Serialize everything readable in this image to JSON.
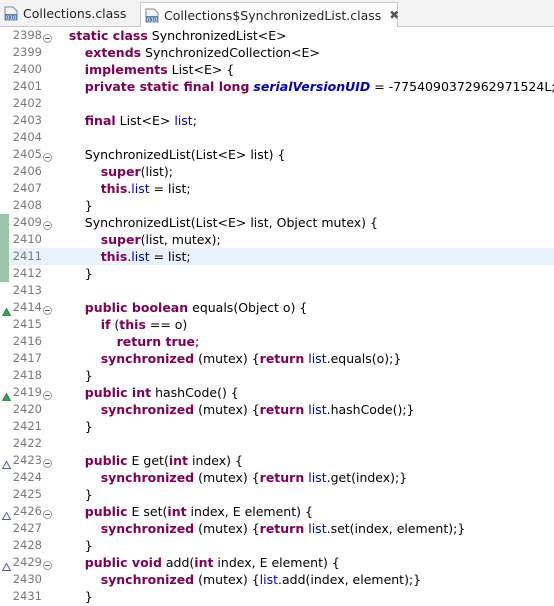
{
  "tabs": [
    {
      "label": "Collections.class",
      "icon": "class-file-icon",
      "active": false
    },
    {
      "label": "Collections$SynchronizedList.class",
      "icon": "class-file-icon",
      "active": true,
      "close": "✖"
    }
  ],
  "lines": [
    {
      "n": "2398",
      "fold": "minus",
      "segs": [
        [
          "",
          "    "
        ],
        [
          "kw",
          "static class"
        ],
        [
          "",
          " SynchronizedList<E>"
        ]
      ]
    },
    {
      "n": "2399",
      "segs": [
        [
          "",
          "        "
        ],
        [
          "kw",
          "extends"
        ],
        [
          "",
          " SynchronizedCollection<E>"
        ]
      ]
    },
    {
      "n": "2400",
      "segs": [
        [
          "",
          "        "
        ],
        [
          "kw",
          "implements"
        ],
        [
          "",
          " List<E> {"
        ]
      ]
    },
    {
      "n": "2401",
      "segs": [
        [
          "",
          "        "
        ],
        [
          "kw",
          "private static final long"
        ],
        [
          "",
          " "
        ],
        [
          "sfld",
          "serialVersionUID"
        ],
        [
          "",
          " = -7754090372962971524L;"
        ]
      ]
    },
    {
      "n": "2402",
      "segs": []
    },
    {
      "n": "2403",
      "segs": [
        [
          "",
          "        "
        ],
        [
          "kw",
          "final"
        ],
        [
          "",
          " List<E> "
        ],
        [
          "fld",
          "list"
        ],
        [
          "",
          ";"
        ]
      ]
    },
    {
      "n": "2404",
      "segs": []
    },
    {
      "n": "2405",
      "fold": "minus",
      "segs": [
        [
          "",
          "        SynchronizedList(List<E> list) {"
        ]
      ]
    },
    {
      "n": "2406",
      "segs": [
        [
          "",
          "            "
        ],
        [
          "kw",
          "super"
        ],
        [
          "",
          "(list);"
        ]
      ]
    },
    {
      "n": "2407",
      "segs": [
        [
          "",
          "            "
        ],
        [
          "kw",
          "this"
        ],
        [
          "",
          "."
        ],
        [
          "fld",
          "list"
        ],
        [
          "",
          " = list;"
        ]
      ]
    },
    {
      "n": "2408",
      "segs": [
        [
          "",
          "        }"
        ]
      ]
    },
    {
      "n": "2409",
      "fold": "minus",
      "marker": true,
      "segs": [
        [
          "",
          "        SynchronizedList(List<E> list, Object mutex) {"
        ]
      ]
    },
    {
      "n": "2410",
      "marker": true,
      "segs": [
        [
          "",
          "            "
        ],
        [
          "kw",
          "super"
        ],
        [
          "",
          "(list, mutex);"
        ]
      ]
    },
    {
      "n": "2411",
      "marker": true,
      "hl": true,
      "segs": [
        [
          "",
          "            "
        ],
        [
          "kw",
          "this"
        ],
        [
          "",
          "."
        ],
        [
          "fld",
          "list"
        ],
        [
          "",
          " = list;"
        ]
      ]
    },
    {
      "n": "2412",
      "marker": true,
      "segs": [
        [
          "",
          "        }"
        ]
      ]
    },
    {
      "n": "2413",
      "segs": []
    },
    {
      "n": "2414",
      "fold": "minus",
      "ov": "override",
      "segs": [
        [
          "",
          "        "
        ],
        [
          "kw",
          "public boolean"
        ],
        [
          "",
          " equals(Object o) {"
        ]
      ]
    },
    {
      "n": "2415",
      "segs": [
        [
          "",
          "            "
        ],
        [
          "kw",
          "if"
        ],
        [
          "",
          " ("
        ],
        [
          "kw",
          "this"
        ],
        [
          "",
          " == o)"
        ]
      ]
    },
    {
      "n": "2416",
      "segs": [
        [
          "",
          "                "
        ],
        [
          "kw",
          "return true"
        ],
        [
          "",
          ";"
        ]
      ]
    },
    {
      "n": "2417",
      "segs": [
        [
          "",
          "            "
        ],
        [
          "kw",
          "synchronized"
        ],
        [
          "",
          " (mutex) {"
        ],
        [
          "kw",
          "return"
        ],
        [
          "",
          " "
        ],
        [
          "fld",
          "list"
        ],
        [
          "",
          ".equals(o);}"
        ]
      ]
    },
    {
      "n": "2418",
      "segs": [
        [
          "",
          "        }"
        ]
      ]
    },
    {
      "n": "2419",
      "fold": "minus",
      "ov": "override",
      "segs": [
        [
          "",
          "        "
        ],
        [
          "kw",
          "public int"
        ],
        [
          "",
          " hashCode() {"
        ]
      ]
    },
    {
      "n": "2420",
      "segs": [
        [
          "",
          "            "
        ],
        [
          "kw",
          "synchronized"
        ],
        [
          "",
          " (mutex) {"
        ],
        [
          "kw",
          "return"
        ],
        [
          "",
          " "
        ],
        [
          "fld",
          "list"
        ],
        [
          "",
          ".hashCode();}"
        ]
      ]
    },
    {
      "n": "2421",
      "segs": [
        [
          "",
          "        }"
        ]
      ]
    },
    {
      "n": "2422",
      "segs": []
    },
    {
      "n": "2423",
      "fold": "minus",
      "ov": "implement",
      "segs": [
        [
          "",
          "        "
        ],
        [
          "kw",
          "public"
        ],
        [
          "",
          " E get("
        ],
        [
          "kw",
          "int"
        ],
        [
          "",
          " index) {"
        ]
      ]
    },
    {
      "n": "2424",
      "segs": [
        [
          "",
          "            "
        ],
        [
          "kw",
          "synchronized"
        ],
        [
          "",
          " (mutex) {"
        ],
        [
          "kw",
          "return"
        ],
        [
          "",
          " "
        ],
        [
          "fld",
          "list"
        ],
        [
          "",
          ".get(index);}"
        ]
      ]
    },
    {
      "n": "2425",
      "segs": [
        [
          "",
          "        }"
        ]
      ]
    },
    {
      "n": "2426",
      "fold": "minus",
      "ov": "implement",
      "segs": [
        [
          "",
          "        "
        ],
        [
          "kw",
          "public"
        ],
        [
          "",
          " E set("
        ],
        [
          "kw",
          "int"
        ],
        [
          "",
          " index, E element) {"
        ]
      ]
    },
    {
      "n": "2427",
      "segs": [
        [
          "",
          "            "
        ],
        [
          "kw",
          "synchronized"
        ],
        [
          "",
          " (mutex) {"
        ],
        [
          "kw",
          "return"
        ],
        [
          "",
          " "
        ],
        [
          "fld",
          "list"
        ],
        [
          "",
          ".set(index, element);}"
        ]
      ]
    },
    {
      "n": "2428",
      "segs": [
        [
          "",
          "        }"
        ]
      ]
    },
    {
      "n": "2429",
      "fold": "minus",
      "ov": "implement",
      "segs": [
        [
          "",
          "        "
        ],
        [
          "kw",
          "public void"
        ],
        [
          "",
          " add("
        ],
        [
          "kw",
          "int"
        ],
        [
          "",
          " index, E element) {"
        ]
      ]
    },
    {
      "n": "2430",
      "segs": [
        [
          "",
          "            "
        ],
        [
          "kw",
          "synchronized"
        ],
        [
          "",
          " (mutex) {"
        ],
        [
          "fld",
          "list"
        ],
        [
          "",
          ".add(index, element);}"
        ]
      ]
    },
    {
      "n": "2431",
      "segs": [
        [
          "",
          "        }"
        ]
      ]
    }
  ],
  "colors": {
    "keyword": "#7f0055",
    "field": "#0000c0",
    "line_highlight": "#e8f2fe",
    "change_marker": "#9dc6a8"
  }
}
